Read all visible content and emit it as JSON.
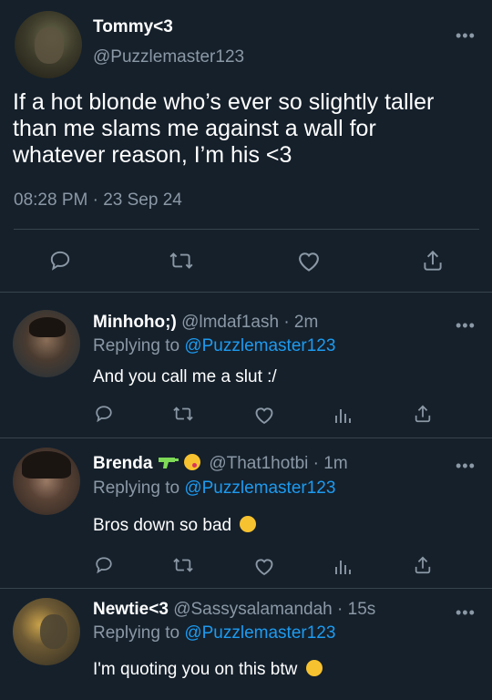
{
  "main": {
    "author_name": "Tommy<3",
    "author_handle": "@Puzzlemaster123",
    "text_line1": "If a hot blonde who’s ever so slightly taller",
    "text_line2": "than me slams me against a wall for",
    "text_line3": "whatever reason, I’m his <3",
    "timestamp": "08:28 PM · 23 Sep 24"
  },
  "replies": [
    {
      "name": "Minhoho;)",
      "handle": "@lmdaf1ash",
      "time": "· 2m",
      "replying_prefix": "Replying to",
      "replying_to": "@Puzzlemaster123",
      "text": "And you call me a slut :/"
    },
    {
      "name": "Brenda",
      "handle": "@That1hotbi",
      "time": "· 1m",
      "replying_prefix": "Replying to",
      "replying_to": "@Puzzlemaster123",
      "text": "Bros down so bad"
    },
    {
      "name": "Newtie<3",
      "handle": "@Sassysalamandah",
      "time": "· 15s",
      "replying_prefix": "Replying to",
      "replying_to": "@Puzzlemaster123",
      "text": "I'm quoting you on this btw"
    }
  ],
  "colors": {
    "background": "#15202b",
    "muted": "#8b98a5",
    "link": "#1d9bf0",
    "divider": "#38444d"
  },
  "icons": [
    "reply-icon",
    "retweet-icon",
    "like-icon",
    "views-icon",
    "share-icon",
    "more-icon"
  ]
}
